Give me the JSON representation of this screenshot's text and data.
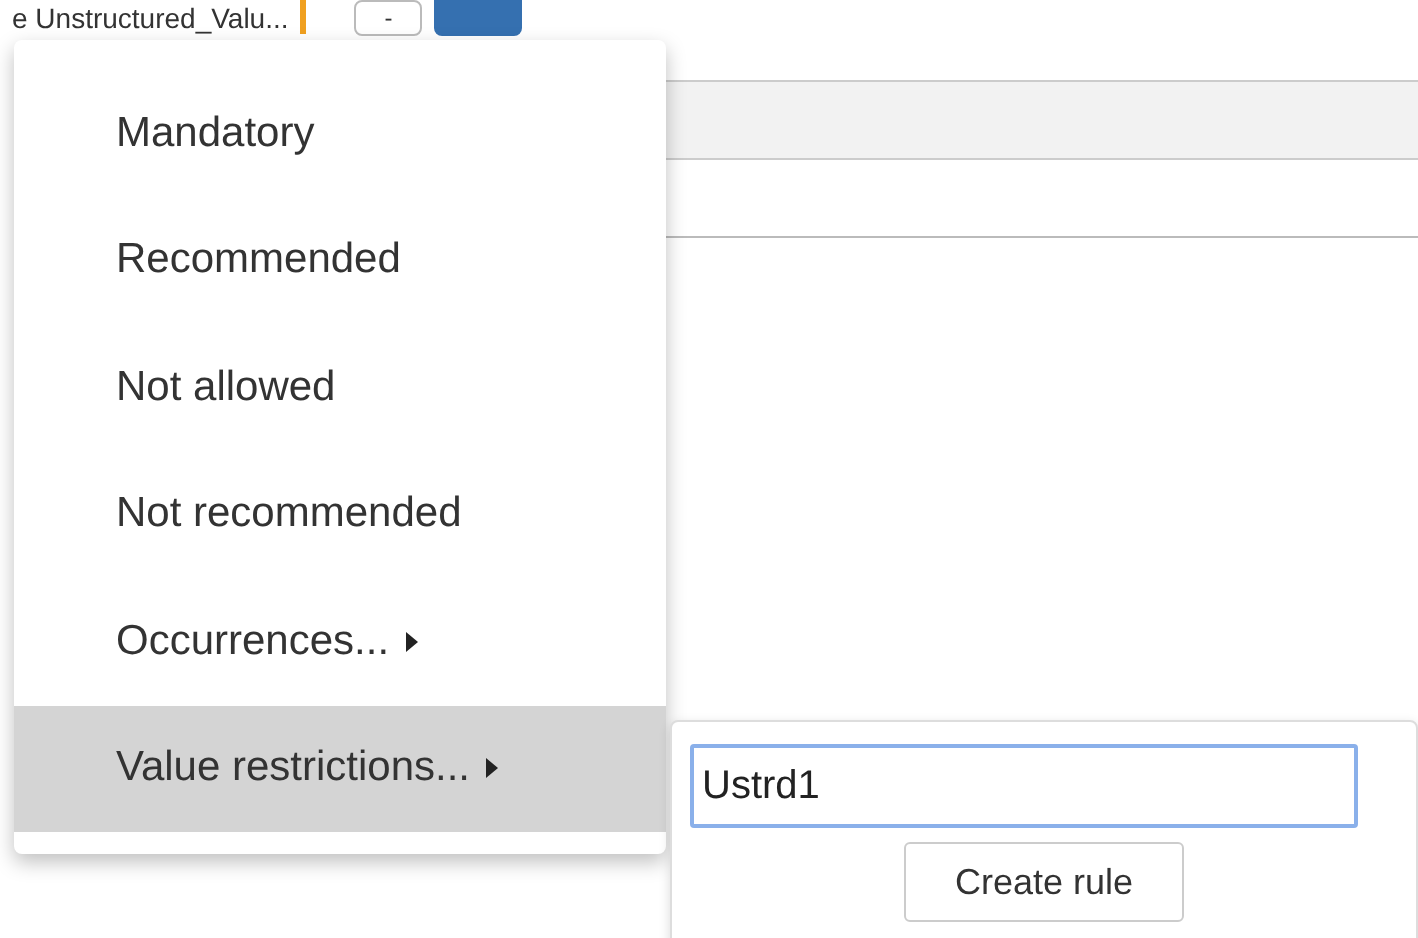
{
  "top_bar": {
    "field_value": "e Unstructured_Valu...",
    "button_label": "-"
  },
  "menu": {
    "items": [
      {
        "label": "Mandatory",
        "submenu": false,
        "selected": false
      },
      {
        "label": "Recommended",
        "submenu": false,
        "selected": false
      },
      {
        "label": "Not allowed",
        "submenu": false,
        "selected": false
      },
      {
        "label": "Not recommended",
        "submenu": false,
        "selected": false
      },
      {
        "label": "Occurrences...",
        "submenu": true,
        "selected": false
      },
      {
        "label": "Value restrictions...",
        "submenu": true,
        "selected": true
      }
    ]
  },
  "submenu": {
    "input_value": "Ustrd1",
    "button": "Create rule"
  }
}
